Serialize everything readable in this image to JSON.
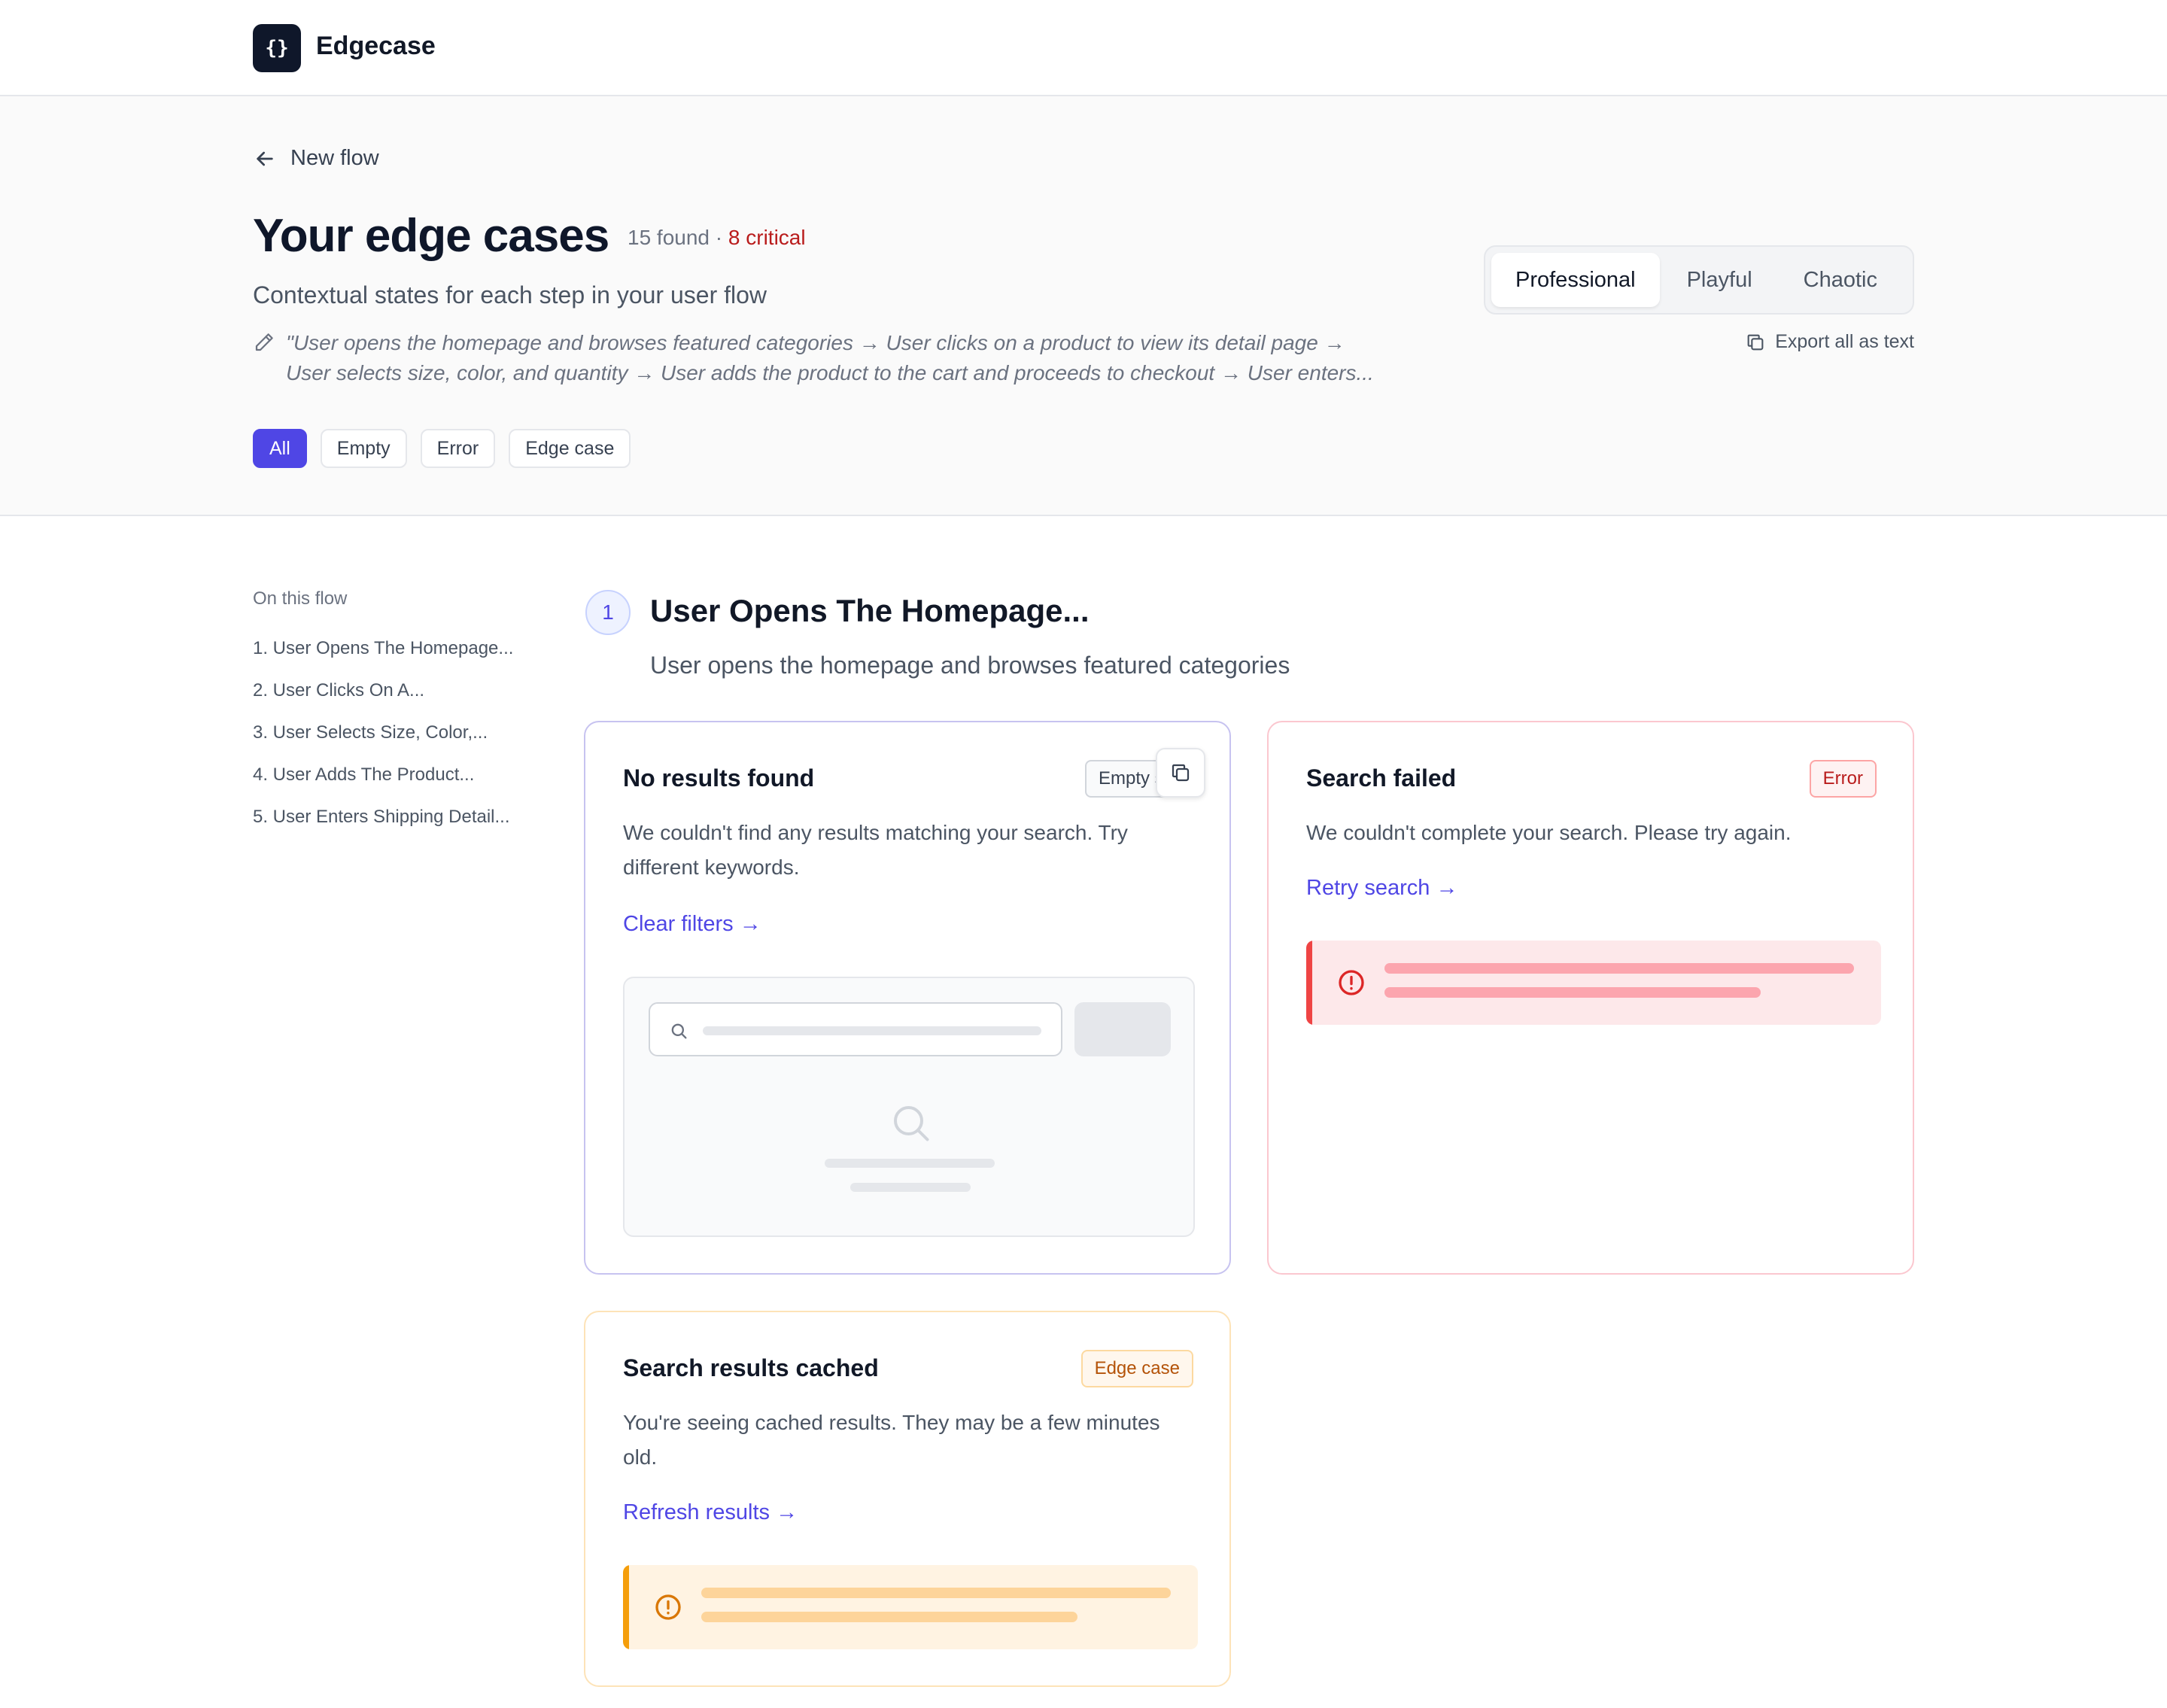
{
  "app": {
    "logo_text": "{}",
    "name": "Edgecase"
  },
  "header": {
    "back_label": "New flow",
    "title": "Your edge cases",
    "found_count": "15 found",
    "separator": " · ",
    "critical_count": "8 critical",
    "subtitle": "Contextual states for each step in your user flow",
    "prompt_line1": "\"User opens the homepage and browses featured categories → User clicks on a product to view its detail page →",
    "prompt_line2": "User selects size, color, and quantity → User adds the product to the cart and proceeds to checkout → User enters..."
  },
  "filters": [
    {
      "label": "All",
      "active": true
    },
    {
      "label": "Empty",
      "active": false
    },
    {
      "label": "Error",
      "active": false
    },
    {
      "label": "Edge case",
      "active": false
    }
  ],
  "tone": {
    "options": [
      "Professional",
      "Playful",
      "Chaotic"
    ],
    "selected": "Professional"
  },
  "export_label": "Export all as text",
  "toc": {
    "title": "On this flow",
    "items": [
      "1. User Opens The Homepage...",
      "2. User Clicks On A...",
      "3. User Selects Size, Color,...",
      "4. User Adds The Product...",
      "5. User Enters Shipping Detail..."
    ]
  },
  "step": {
    "number": "1",
    "title": "User Opens The Homepage...",
    "description": "User opens the homepage and browses featured categories"
  },
  "cards": {
    "empty": {
      "title": "No results found",
      "badge": "Empty state",
      "text": "We couldn't find any results matching your search. Try different keywords.",
      "link": "Clear filters →"
    },
    "error": {
      "title": "Search failed",
      "badge": "Error",
      "text": "We couldn't complete your search. Please try again.",
      "link": "Retry search →"
    },
    "edge": {
      "title": "Search results cached",
      "badge": "Edge case",
      "text": "You're seeing cached results. They may be a few minutes old.",
      "link": "Refresh results →"
    }
  },
  "colors": {
    "accent": "#4f46e5",
    "critical": "#b91c1c",
    "error": "#ef4444",
    "warning": "#f59e0b",
    "logo_bg": "#0f172a"
  },
  "icons": {
    "back": "arrow-left-icon",
    "prompt": "pencil-icon",
    "export": "copy-icon",
    "copy": "copy-icon",
    "search": "search-icon",
    "error": "alert-circle-icon",
    "warning": "alert-circle-icon"
  }
}
